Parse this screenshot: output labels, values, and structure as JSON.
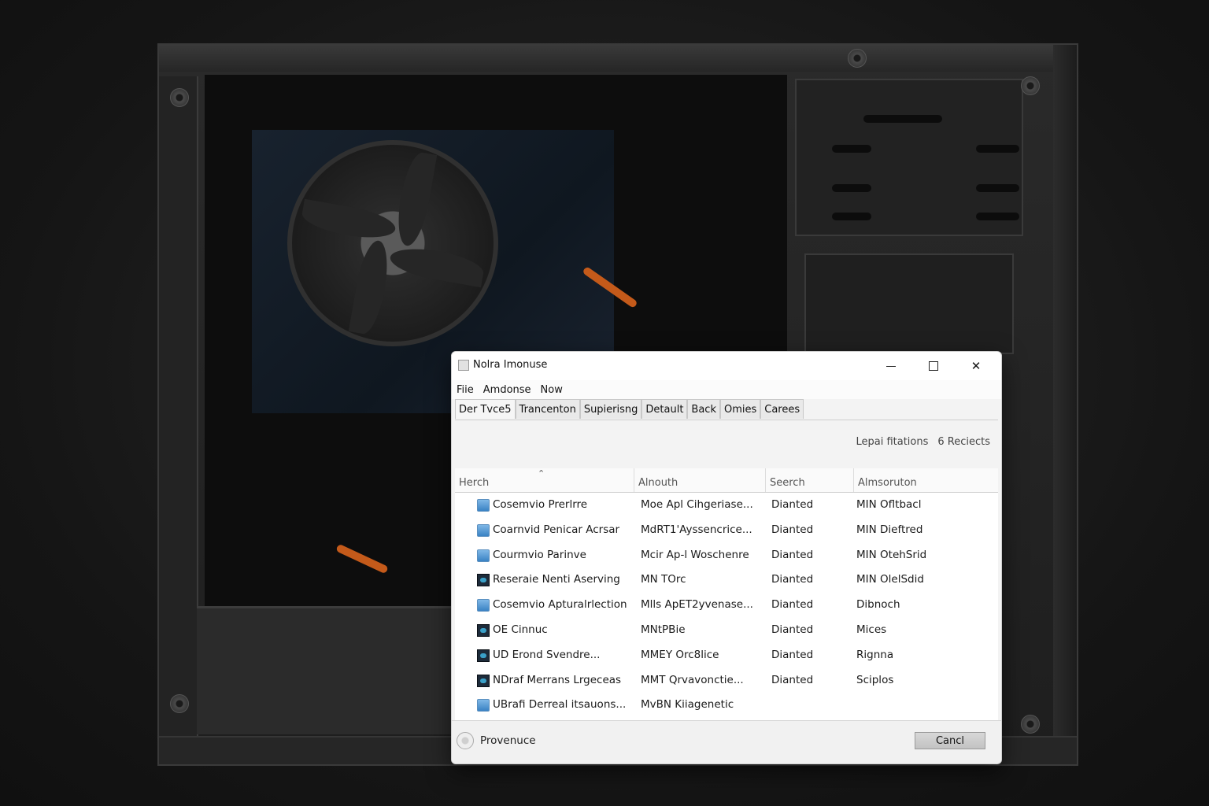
{
  "window": {
    "title": "Nolra Imonuse",
    "controls": {
      "minimize": "",
      "maximize": "",
      "close": "✕"
    }
  },
  "menu": [
    {
      "label": "Fiie"
    },
    {
      "label": "Amdonse"
    },
    {
      "label": "Now"
    }
  ],
  "tabs": [
    {
      "label": "Der Tvce5"
    },
    {
      "label": "Trancenton"
    },
    {
      "label": "Supierisng"
    },
    {
      "label": "Detault"
    },
    {
      "label": "Back"
    },
    {
      "label": "Omies"
    },
    {
      "label": "Carees"
    }
  ],
  "status": {
    "left": "Lepai fitations",
    "right": "6 Reciects"
  },
  "columns": [
    {
      "label": "Herch"
    },
    {
      "label": "Alnouth"
    },
    {
      "label": "Seerch"
    },
    {
      "label": "Almsoruton"
    }
  ],
  "rows": [
    {
      "icon": "blue-app-icon",
      "name": "Cosemvio Prerlrre",
      "c2": "Moe Apl Cihgeriase...",
      "c3": "Dianted",
      "c4": "MIN Ofltbacl"
    },
    {
      "icon": "blue-app-icon",
      "name": "Coarnvid Penicar Acrsar",
      "c2": "MdRT1'Ayssencrice...",
      "c3": "Dianted",
      "c4": "MIN Dieftred"
    },
    {
      "icon": "blue-app-icon",
      "name": "Courmvio Parinve",
      "c2": "Mcir Ap-l Woschenre",
      "c3": "Dianted",
      "c4": "MIN OtehSrid"
    },
    {
      "icon": "dark-app-icon",
      "name": "Reseraie Nenti Aserving",
      "c2": "MN TOrc",
      "c3": "Dianted",
      "c4": "MIN OlelSdid"
    },
    {
      "icon": "blue-app-icon",
      "name": "Cosemvio Apturalrlection",
      "c2": "Mlls ApET2yvenase...",
      "c3": "Dianted",
      "c4": "Dibnoch"
    },
    {
      "icon": "dark-app-icon",
      "name": "OE Cinnuc",
      "c2": "MNtPBie",
      "c3": "Dianted",
      "c4": "Mices"
    },
    {
      "icon": "dark-app-icon",
      "name": "UD Erond Svendre...",
      "c2": "MMEY Orc8lice",
      "c3": "Dianted",
      "c4": "Rignna"
    },
    {
      "icon": "dark-app-icon",
      "name": "NDraf Merrans Lrgeceas",
      "c2": "MMT Qrvavonctie...",
      "c3": "Dianted",
      "c4": "Sciplos"
    },
    {
      "icon": "blue-app-icon",
      "name": "UBrafi Derreal itsauons...",
      "c2": "MvBN Kiiagenetic",
      "c3": "",
      "c4": ""
    }
  ],
  "footer": {
    "label": "Provenuce",
    "cancel": "Cancl"
  }
}
